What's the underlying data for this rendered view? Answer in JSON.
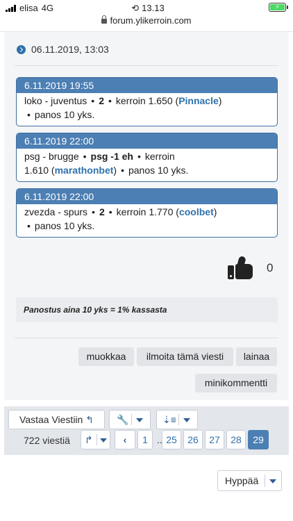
{
  "status_bar": {
    "carrier": "elisa",
    "network": "4G",
    "time": "13.13"
  },
  "url_bar": {
    "domain": "forum.ylikerroin.com"
  },
  "post": {
    "date": "06.11.2019, 13:03",
    "quotes": [
      {
        "header": "6.11.2019 19:55",
        "match": "loko - juventus",
        "pick": "2",
        "odds_label": "kerroin",
        "odds": "1.650",
        "bookmaker": "Pinnacle",
        "stake": "panos 10 yks."
      },
      {
        "header": "6.11.2019 22:00",
        "match": "psg - brugge",
        "pick": "psg -1 eh",
        "odds_label": "kerroin",
        "odds": "1.610",
        "bookmaker": "marathonbet",
        "stake": "panos 10 yks."
      },
      {
        "header": "6.11.2019 22:00",
        "match": "zvezda - spurs",
        "pick": "2",
        "odds_label": "kerroin",
        "odds": "1.770",
        "bookmaker": "coolbet",
        "stake": "panos 10 yks."
      }
    ],
    "like_count": "0",
    "signature": "Panostus aina 10 yks = 1% kassasta",
    "actions": {
      "edit": "muokkaa",
      "report": "ilmoita tämä viesti",
      "quote": "lainaa",
      "mini_comment": "minikommentti"
    }
  },
  "pagination": {
    "reply_label": "Vastaa Viestiin",
    "total": "722 viestiä",
    "pages": [
      "1",
      "25",
      "26",
      "27",
      "28",
      "29"
    ],
    "current_page": "29",
    "ellipsis": "..."
  },
  "jump_label": "Hyppää",
  "colors": {
    "accent": "#4c7fb3",
    "link": "#2f71ac",
    "battery": "#4cd964"
  }
}
